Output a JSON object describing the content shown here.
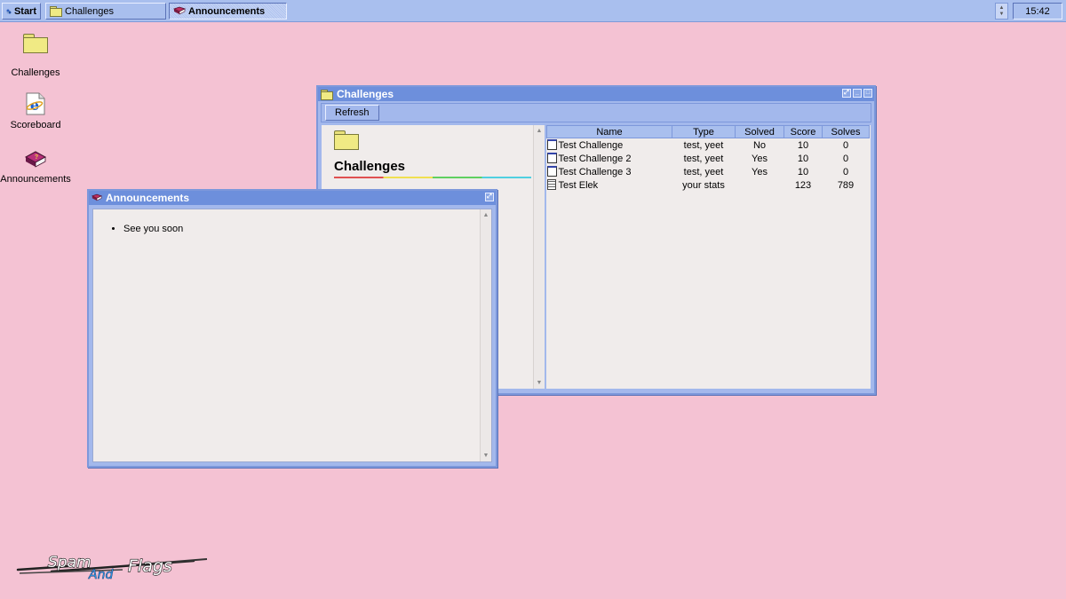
{
  "taskbar": {
    "start_label": "Start",
    "tasks": [
      {
        "label": "Challenges",
        "icon": "folder-icon",
        "active": false
      },
      {
        "label": "Announcements",
        "icon": "book-icon",
        "active": true
      }
    ],
    "clock": "15:42"
  },
  "desktop": {
    "icons": [
      {
        "label": "Challenges",
        "icon": "folder-icon"
      },
      {
        "label": "Scoreboard",
        "icon": "internet-explorer-icon"
      },
      {
        "label": "Announcements",
        "icon": "book-icon"
      }
    ]
  },
  "challenges_window": {
    "title": "Challenges",
    "refresh_label": "Refresh",
    "sidebar_heading": "Challenges",
    "columns": [
      "Name",
      "Type",
      "Solved",
      "Score",
      "Solves"
    ],
    "rows": [
      {
        "name": "Test Challenge",
        "type": "test, yeet",
        "solved": "No",
        "score": "10",
        "solves": "0",
        "icon": "document-icon"
      },
      {
        "name": "Test Challenge 2",
        "type": "test, yeet",
        "solved": "Yes",
        "score": "10",
        "solves": "0",
        "icon": "document-icon"
      },
      {
        "name": "Test Challenge 3",
        "type": "test, yeet",
        "solved": "Yes",
        "score": "10",
        "solves": "0",
        "icon": "document-icon"
      },
      {
        "name": "Test Elek",
        "type": "your stats",
        "solved": "",
        "score": "123",
        "solves": "789",
        "icon": "stats-icon"
      }
    ]
  },
  "announcements_window": {
    "title": "Announcements",
    "items": [
      "See you soon"
    ]
  },
  "logo": {
    "text_1": "Spam",
    "text_2": "And",
    "text_3": "Flags"
  }
}
